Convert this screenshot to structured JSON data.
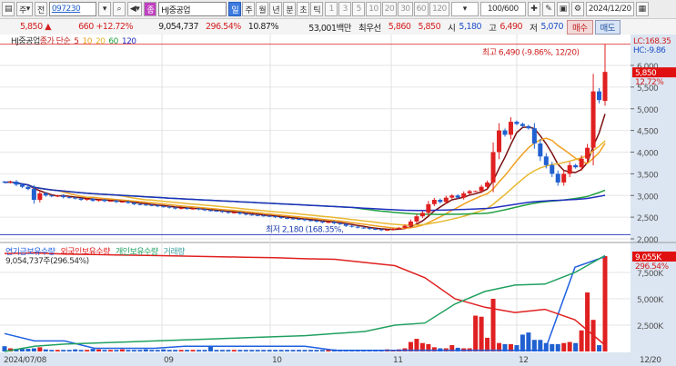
{
  "toolbar": {
    "menu_icon": "window-icon",
    "period_select": "주",
    "prev_label": "전",
    "code": "097230",
    "stock_badge": "종",
    "stock_name": "HJ중공업",
    "periods": [
      "일",
      "주",
      "월",
      "년",
      "분",
      "초",
      "틱"
    ],
    "selected_period": "일",
    "minutes": [
      "1",
      "3",
      "5",
      "10",
      "20",
      "30",
      "60",
      "120"
    ],
    "count": "100/600",
    "date": "2024/12/20"
  },
  "quote": {
    "price": "5,850",
    "arrow": "▲",
    "change": "660",
    "change_pct": "+12.72%",
    "volume": "9,054,737",
    "volume_ratio": "296.54%",
    "turnover": "10.87%",
    "amount": "53,001백만",
    "best_label": "최우선",
    "best_ask": "5,860",
    "best_bid": "5,850",
    "open_label": "시",
    "open": "5,180",
    "high_label": "고",
    "high": "6,490",
    "low_label": "저",
    "low": "5,070",
    "buy_label": "매수",
    "sell_label": "매도"
  },
  "legend": {
    "name": "HJ중공업",
    "ma_label": "종가 단순",
    "ma": [
      "5",
      "10",
      "20",
      "60",
      "120"
    ],
    "ma_colors": [
      "#7a1010",
      "#f0a020",
      "#e8b830",
      "#20a040",
      "#2030c0"
    ]
  },
  "price_axis": {
    "ticks": [
      "6,000",
      "5,500",
      "5,000",
      "4,500",
      "4,000",
      "3,500",
      "3,000",
      "2,500",
      "2,000"
    ],
    "lc": "LC:168.35",
    "hc": "HC:-9.86",
    "current": "5,850",
    "current_pct": "12.72%"
  },
  "annotations": {
    "high": "최고 6,490 (-9.86%, 12/20)",
    "low": "최저 2,180 (168.35%,"
  },
  "volume_panel": {
    "legend": [
      "연기금보유수량",
      "외국인보유수량",
      "개인보유수량",
      "거래량"
    ],
    "legend_colors": [
      "#2060e0",
      "#e02020",
      "#20a060",
      "#40a0a0"
    ],
    "readout": "9,054,737주(296.54%)",
    "ticks": [
      "7,500K",
      "5,000K",
      "2,500K"
    ],
    "current": "9,055K",
    "current_pct": "296.54%"
  },
  "date_axis": {
    "labels": [
      "2024/07/08",
      "09",
      "10",
      "11",
      "12"
    ],
    "end": "12/20"
  },
  "chart_data": {
    "type": "candlestick",
    "closes": [
      3300,
      3320,
      3250,
      3200,
      3150,
      2900,
      3050,
      3000,
      2980,
      3000,
      2960,
      2950,
      2930,
      2900,
      2920,
      2880,
      2900,
      2870,
      2880,
      2850,
      2860,
      2830,
      2800,
      2790,
      2780,
      2770,
      2750,
      2740,
      2720,
      2700,
      2710,
      2690,
      2700,
      2680,
      2660,
      2650,
      2640,
      2620,
      2600,
      2610,
      2580,
      2560,
      2550,
      2540,
      2530,
      2520,
      2500,
      2480,
      2470,
      2460,
      2450,
      2430,
      2420,
      2400,
      2380,
      2390,
      2360,
      2340,
      2300,
      2280,
      2260,
      2250,
      2230,
      2220,
      2200,
      2210,
      2230,
      2250,
      2300,
      2400,
      2520,
      2600,
      2800,
      2900,
      2850,
      2950,
      3000,
      2950,
      3050,
      3100,
      3100,
      3200,
      3300,
      4000,
      4500,
      4400,
      4700,
      4650,
      4600,
      4550,
      4200,
      3900,
      3700,
      3500,
      3300,
      3500,
      3700,
      3650,
      3850,
      4100,
      5400,
      5200,
      5850
    ],
    "last_candle": {
      "open": 5180,
      "high": 6490,
      "low": 5070,
      "close": 5850
    },
    "volumes_k": [
      500,
      300,
      250,
      250,
      250,
      300,
      400,
      200,
      150,
      150,
      150,
      150,
      200,
      150,
      150,
      250,
      200,
      150,
      150,
      150,
      200,
      150,
      150,
      150,
      200,
      150,
      150,
      200,
      150,
      150,
      150,
      150,
      150,
      150,
      150,
      500,
      150,
      150,
      150,
      150,
      150,
      150,
      150,
      150,
      150,
      150,
      150,
      150,
      150,
      150,
      150,
      150,
      150,
      150,
      150,
      150,
      200,
      150,
      150,
      150,
      150,
      150,
      150,
      150,
      150,
      200,
      150,
      200,
      300,
      900,
      1200,
      800,
      700,
      400,
      300,
      300,
      600,
      350,
      300,
      300,
      3400,
      3300,
      1300,
      5000,
      800,
      700,
      700,
      600,
      1600,
      1800,
      1100,
      1100,
      800,
      700,
      700,
      800,
      900,
      800,
      2000,
      5600,
      3000,
      600,
      9055
    ],
    "foreign_k": [
      9300,
      9350,
      9250,
      9200,
      9150,
      9100,
      9050,
      9000,
      8950,
      8900,
      8800,
      8750,
      8450,
      8150,
      7000,
      5000,
      4200,
      3700,
      4000,
      3000,
      600
    ],
    "individual_k": [
      0,
      500,
      700,
      800,
      900,
      1000,
      1100,
      1200,
      1300,
      1400,
      1500,
      1700,
      1900,
      2500,
      2700,
      4500,
      5700,
      6300,
      6400,
      7500,
      9100
    ],
    "pension_k": [
      1700,
      1000,
      1000,
      300,
      300,
      300,
      500,
      500,
      500,
      500,
      500,
      100,
      100,
      100,
      100,
      100,
      100,
      100,
      100,
      8000,
      9000
    ],
    "price_range": [
      2000,
      6500
    ],
    "volume_range_k": [
      0,
      10000
    ],
    "up_color": "#e02020",
    "down_color": "#2060d0"
  }
}
